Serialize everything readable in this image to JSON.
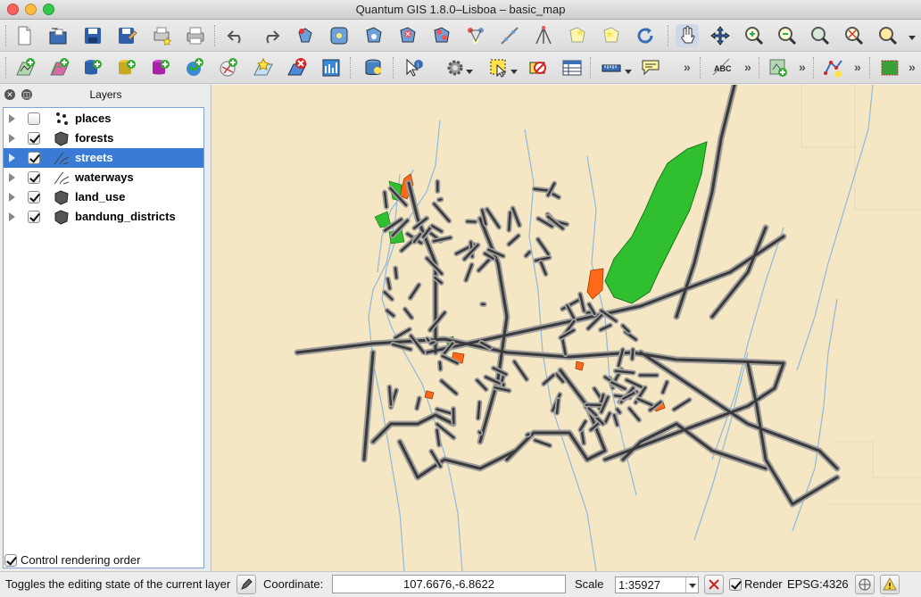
{
  "window": {
    "title": "Quantum GIS 1.8.0–Lisboa – basic_map"
  },
  "toolbar1": {
    "icons": [
      "new-project-icon",
      "open-project-icon",
      "save-project-icon",
      "save-as-icon",
      "new-print-composer-icon",
      "print-icon",
      "undo-icon",
      "redo-icon",
      "current-edits-icon",
      "add-feature-icon",
      "move-feature-icon",
      "node-tool-icon",
      "delete-selected-icon",
      "cut-features-icon",
      "copy-features-icon",
      "paste-features-icon",
      "capture-icon",
      "pan-icon",
      "pan-to-selection-icon",
      "zoom-in-icon",
      "zoom-out-icon",
      "zoom-full-icon",
      "zoom-to-layer-icon",
      "zoom-to-selection-icon"
    ]
  },
  "toolbar2": {
    "icons": [
      "add-vector-layer-icon",
      "add-raster-layer-icon",
      "add-postgis-layer-icon",
      "add-spatialite-layer-icon",
      "add-mssql-layer-icon",
      "add-wms-layer-icon",
      "add-wfs-layer-icon",
      "new-shapefile-layer-icon",
      "remove-layer-icon",
      "new-spatialite-layer-icon",
      "add-delimited-text-icon",
      "database-icon",
      "identify-icon",
      "actions-icon",
      "select-icon",
      "deselect-icon",
      "attribute-table-icon",
      "measure-icon",
      "map-tips-icon",
      "labeling-icon",
      "georeferencer-icon",
      "digitize-icon",
      "raster-icon"
    ],
    "overflow": "»"
  },
  "layers_panel": {
    "title": "Layers",
    "layers": [
      {
        "name": "places",
        "checked": false,
        "icon": "point-layer-icon",
        "selected": false
      },
      {
        "name": "forests",
        "checked": true,
        "icon": "polygon-layer-icon",
        "selected": false
      },
      {
        "name": "streets",
        "checked": true,
        "icon": "line-layer-icon",
        "selected": true
      },
      {
        "name": "waterways",
        "checked": true,
        "icon": "line-layer-icon",
        "selected": false
      },
      {
        "name": "land_use",
        "checked": true,
        "icon": "polygon-layer-icon",
        "selected": false
      },
      {
        "name": "bandung_districts",
        "checked": true,
        "icon": "polygon-layer-icon",
        "selected": false
      }
    ],
    "control_rendering_order": {
      "label": "Control rendering order",
      "checked": true
    }
  },
  "map": {
    "background": "#f5e6c4",
    "street_color": "#3a3a3a",
    "street_casing": "#9e9e9e",
    "forest_color": "#2fbf2f",
    "landuse_color": "#ff6a1a",
    "water_color": "#8fb9de"
  },
  "status": {
    "message": "Toggles the editing state of the current layer",
    "coordinate_label": "Coordinate:",
    "coordinate_value": "107.6676,-6.8622",
    "scale_label": "Scale",
    "scale_value": "1:35927",
    "render_label": "Render",
    "render_checked": true,
    "crs": "EPSG:4326"
  }
}
